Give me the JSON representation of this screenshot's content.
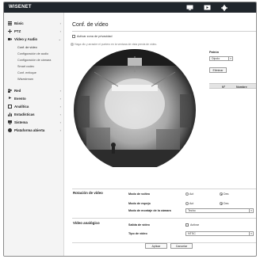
{
  "header": {
    "brand": "WISENET",
    "icons": [
      "monitor-icon",
      "playback-icon",
      "gear-icon"
    ]
  },
  "sidebar": {
    "items": [
      {
        "label": "Básic",
        "icon": "grid-icon",
        "arrow": "›"
      },
      {
        "label": "PTZ",
        "icon": "move-arrows-icon",
        "arrow": "›"
      },
      {
        "label": "Vídeo y Audio",
        "icon": "video-camera-icon",
        "arrow": "⌄"
      },
      {
        "label": "Red",
        "icon": "network-icon",
        "arrow": "›"
      },
      {
        "label": "Evento",
        "icon": "event-icon",
        "arrow": "›"
      },
      {
        "label": "Analítica",
        "icon": "analytics-icon",
        "arrow": "›"
      },
      {
        "label": "Estadísticas",
        "icon": "bar-chart-icon",
        "arrow": "›"
      },
      {
        "label": "Sistema",
        "icon": "system-icon",
        "arrow": "›"
      },
      {
        "label": "Plataforma abierta",
        "icon": "platform-icon",
        "arrow": "›"
      }
    ],
    "subitems": [
      "Conf. de vídeo",
      "Configuración de audio",
      "Configuración de cámara",
      "Smart codec",
      "Conf. enfoque",
      "Wisestream"
    ]
  },
  "main": {
    "title": "Conf. de vídeo",
    "privacy_checkbox_label": "Activar zona de privacidad",
    "hint": "Haga clic y arrastre el puntero en la ventana de vista previa de vídeo.",
    "patrol": {
      "label": "Patrón",
      "selected": "Dipolo",
      "delete_button": "Eliminar",
      "columns": [
        "Nº",
        "Nombre"
      ]
    },
    "rotation": {
      "section_title": "Rotación de vídeo",
      "rows": [
        {
          "label": "Modo de volteo",
          "options": [
            "Act",
            "Des"
          ],
          "selected": "Des"
        },
        {
          "label": "Modo de espejo",
          "options": [
            "Act",
            "Des"
          ],
          "selected": "Des"
        },
        {
          "label": "Modo de montaje de la cámara",
          "value": "Techo"
        }
      ]
    },
    "analog": {
      "section_title": "Vídeo analógico",
      "output_label": "Salida de vídeo",
      "output_checkbox": "Activar",
      "type_label": "Tipo de vídeo",
      "type_value": "NTSC"
    },
    "buttons": {
      "apply": "Aplicar",
      "cancel": "Cancelar"
    }
  },
  "colors": {
    "topbar": "#20262c",
    "sidebar": "#f4f4f4"
  }
}
